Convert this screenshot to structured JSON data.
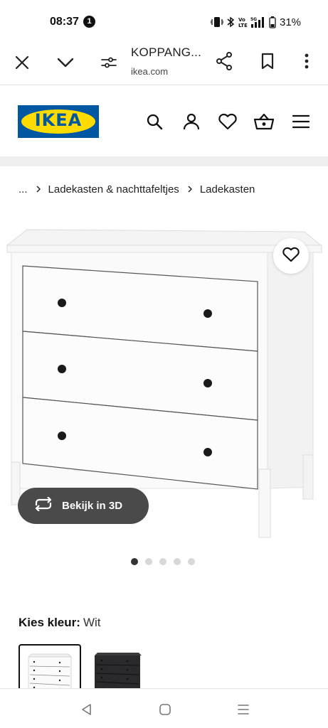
{
  "status_bar": {
    "time": "08:37",
    "notification_count": "1",
    "battery": "31%",
    "icons": [
      "vibrate-icon",
      "bluetooth-icon",
      "volte-icon",
      "5g-signal-icon",
      "battery-icon"
    ]
  },
  "browser": {
    "title": "KOPPANG...",
    "url": "ikea.com",
    "icons": [
      "close-icon",
      "chevron-down-icon",
      "page-settings-icon",
      "share-icon",
      "bookmark-icon",
      "more-vert-icon"
    ]
  },
  "site_header": {
    "logo_text": "IKEA",
    "logo_colors": {
      "blue": "#0058a3",
      "yellow": "#ffdb00"
    },
    "icons": [
      "search-icon",
      "account-icon",
      "favorites-icon",
      "cart-icon",
      "menu-icon"
    ]
  },
  "breadcrumb": {
    "items": [
      "...",
      "Ladekasten & nachttafeltjes",
      "Ladekasten"
    ]
  },
  "product": {
    "image_alt": "white chest of 3 drawers",
    "view_3d_label": "Bekijk in 3D",
    "gallery_total": 5,
    "gallery_active": 1
  },
  "color_picker": {
    "label": "Kies kleur:",
    "selected": "Wit",
    "options": [
      {
        "name": "white",
        "color": "#ffffff",
        "selected": true
      },
      {
        "name": "black-brown",
        "color": "#2a2a2c",
        "selected": false
      }
    ]
  },
  "nav_bar": {
    "icons": [
      "back-icon",
      "home-icon",
      "recents-icon"
    ]
  }
}
